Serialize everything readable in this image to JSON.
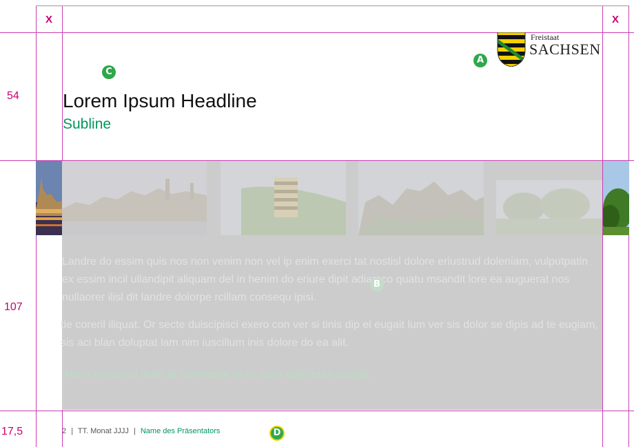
{
  "corner_markers": {
    "left": "X",
    "right": "X"
  },
  "measurements": {
    "top": "54",
    "middle": "107",
    "bottom": "17,5"
  },
  "badges": {
    "a": "A",
    "b": "B",
    "c": "C",
    "d": "D"
  },
  "logo": {
    "line1": "Freistaat",
    "line2": "SACHSEN"
  },
  "headline": "Lorem Ipsum Headline",
  "subline": "Subline",
  "body": {
    "paragraph1": "Landre do essim quis nos non venim non vel ip enim exerci tat nostisl dolore eriustrud doleniam, vulputpatin ex essim incil ullandipit aliquam del in henim do eriure dipit adiamco quatu msandit lore ea auguerat nos nullaorer ilisl dit landre dolorpe rcillam consequ ipisi.",
    "paragraph2": "tie coreril iliquat. Or secte duiscipisci exero con ver si tinis dip el eugait lum ver sis dolor se dipis ad te eugiam, sis aci blan doluptat lam nim iuscillum inis dolore do ea alit.",
    "highlight": "Atum niscincil dunt at nonsequi te ex euis adip euis augait."
  },
  "footer": {
    "page_number": "2",
    "separator": "|",
    "date": "TT. Monat JJJJ",
    "presenter": "Name des Präsentators"
  },
  "colors": {
    "guide": "#c83cb4",
    "marker": "#c8006e",
    "accent_green": "#00965a",
    "badge_green": "#2ea84a",
    "overlay_gray": "#cccccc"
  }
}
